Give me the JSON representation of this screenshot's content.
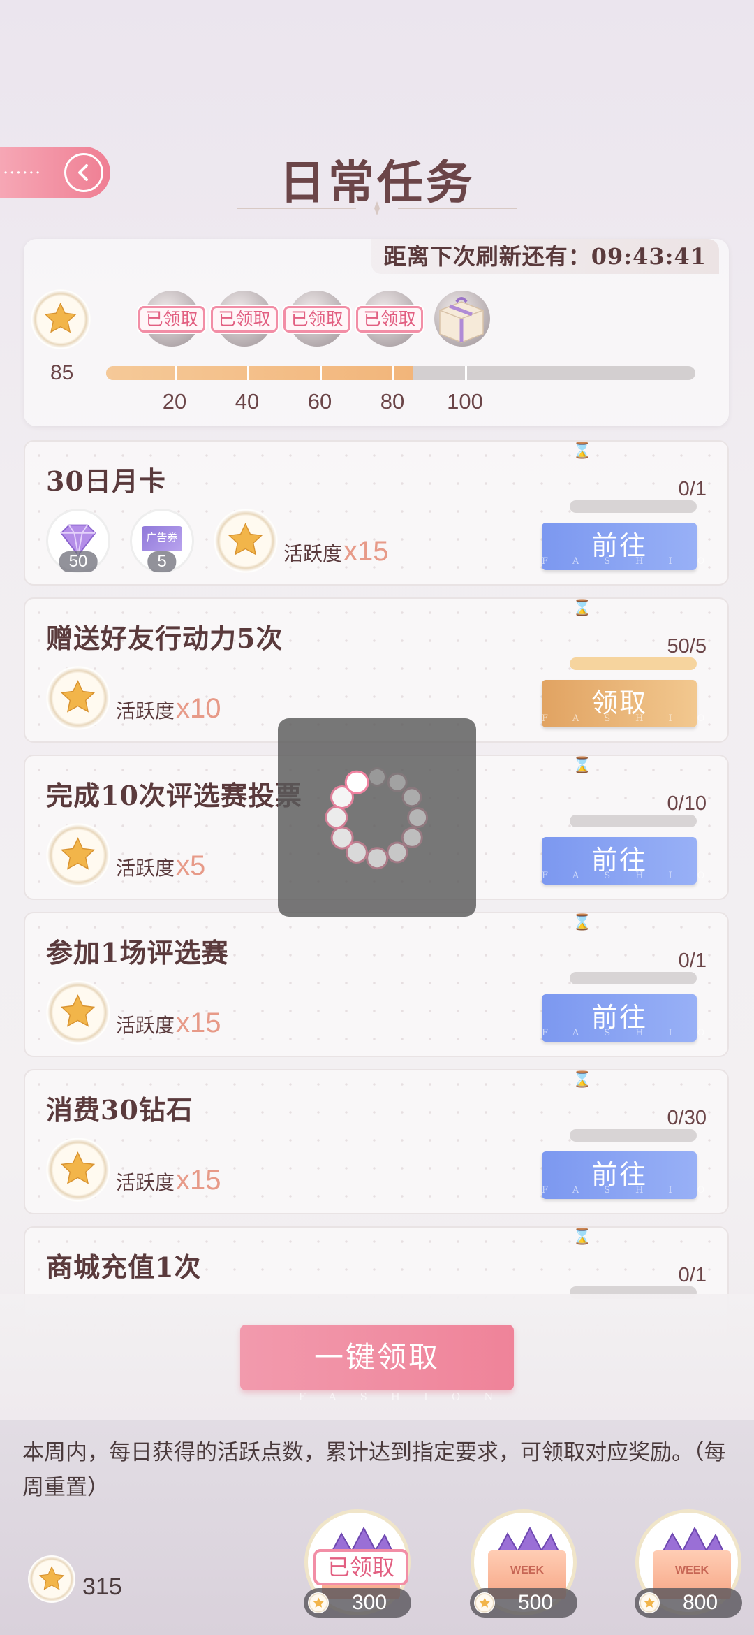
{
  "colors": {
    "accent_pink": "#ef8399",
    "go_blue": "#7c98f0",
    "claim_orange": "#e1a362",
    "title_brown": "#6b4548"
  },
  "header": {
    "title": "日常任务",
    "back_icon": "chevron-left-icon"
  },
  "activity": {
    "refresh_text": "距离下次刷新还有：09:43:41",
    "current": "85",
    "progress_fraction": 0.52,
    "milestones": [
      {
        "label": "20",
        "status": "已领取"
      },
      {
        "label": "40",
        "status": "已领取"
      },
      {
        "label": "60",
        "status": "已领取"
      },
      {
        "label": "80",
        "status": "已领取"
      },
      {
        "label": "100",
        "status": ""
      }
    ]
  },
  "tasks": [
    {
      "title": "30日月卡",
      "progress": "0/1",
      "fill": 0,
      "button": "前往",
      "reward_label": "活跃度",
      "reward_mult": "x15",
      "diamond_count": "50",
      "ticket_label": "广告券",
      "ticket_count": "5"
    },
    {
      "title": "赠送好友行动力5次",
      "progress": "50/5",
      "fill": 1,
      "button": "领取",
      "reward_label": "活跃度",
      "reward_mult": "x10"
    },
    {
      "title": "完成10次评选赛投票",
      "progress": "0/10",
      "fill": 0,
      "button": "前往",
      "reward_label": "活跃度",
      "reward_mult": "x5"
    },
    {
      "title": "参加1场评选赛",
      "progress": "0/1",
      "fill": 0,
      "button": "前往",
      "reward_label": "活跃度",
      "reward_mult": "x15"
    },
    {
      "title": "消费30钻石",
      "progress": "0/30",
      "fill": 0,
      "button": "前往",
      "reward_label": "活跃度",
      "reward_mult": "x15"
    },
    {
      "title": "商城充值1次",
      "progress": "0/1",
      "fill": 0
    }
  ],
  "button_watermark": "FASHION",
  "claim_all": "一键领取",
  "weekly": {
    "description": "本周内，每日获得的活跃点数，累计达到指定要求，可领取对应奖励。（每周重置）",
    "total": "315",
    "chests": [
      {
        "requirement": "300",
        "status": "已领取",
        "tag": ""
      },
      {
        "requirement": "500",
        "status": "",
        "tag": "WEEK"
      },
      {
        "requirement": "800",
        "status": "",
        "tag": "WEEK"
      }
    ]
  }
}
